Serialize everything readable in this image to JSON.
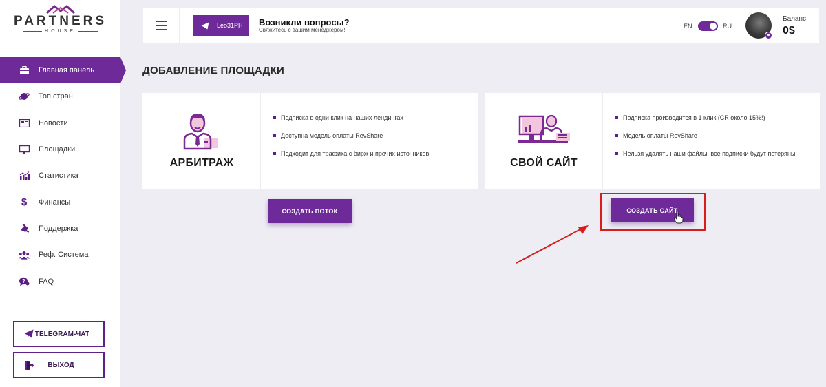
{
  "logo": {
    "main": "PARTNERS",
    "sub": "HOUSE"
  },
  "sidebar": {
    "items": [
      {
        "label": "Главная панель",
        "icon": "briefcase-icon",
        "active": true
      },
      {
        "label": "Топ стран",
        "icon": "planet-icon"
      },
      {
        "label": "Новости",
        "icon": "newspaper-icon"
      },
      {
        "label": "Площадки",
        "icon": "monitor-icon"
      },
      {
        "label": "Статистика",
        "icon": "chart-icon"
      },
      {
        "label": "Финансы",
        "icon": "dollar-icon"
      },
      {
        "label": "Поддержка",
        "icon": "support-icon"
      },
      {
        "label": "Реф. Система",
        "icon": "users-icon"
      },
      {
        "label": "FAQ",
        "icon": "faq-icon"
      }
    ],
    "telegram_button": "TELEGRAM-ЧАТ",
    "exit_button": "ВЫХОД"
  },
  "header": {
    "manager_chip": "Leo31PH",
    "question_title": "Возникли вопросы?",
    "question_sub": "Свяжитесь с вашим менеджером!",
    "lang_en": "EN",
    "lang_ru": "RU",
    "balance_label": "Баланс",
    "balance_value": "0$"
  },
  "main": {
    "title": "ДОБАВЛЕНИЕ ПЛОЩАДКИ",
    "cards": [
      {
        "name": "АРБИТРАЖ",
        "features": [
          "Подписка в одни клик на наших лендингах",
          "Доступна модель оплаты RevShare",
          "Подходит для трафика с бирж и прочих источников"
        ],
        "button": "СОЗДАТЬ ПОТОК"
      },
      {
        "name": "СВОЙ САЙТ",
        "features": [
          "Подписка производится в 1 клик (CR около 15%!)",
          "Модель оплаты RevShare",
          "Нельзя удалять наши файлы, все подписки будут потеряны!"
        ],
        "button": "СОЗДАТЬ САЙТ"
      }
    ]
  },
  "colors": {
    "accent": "#6d2a98",
    "background": "#eeedf3",
    "annotation": "#d91c1c"
  }
}
